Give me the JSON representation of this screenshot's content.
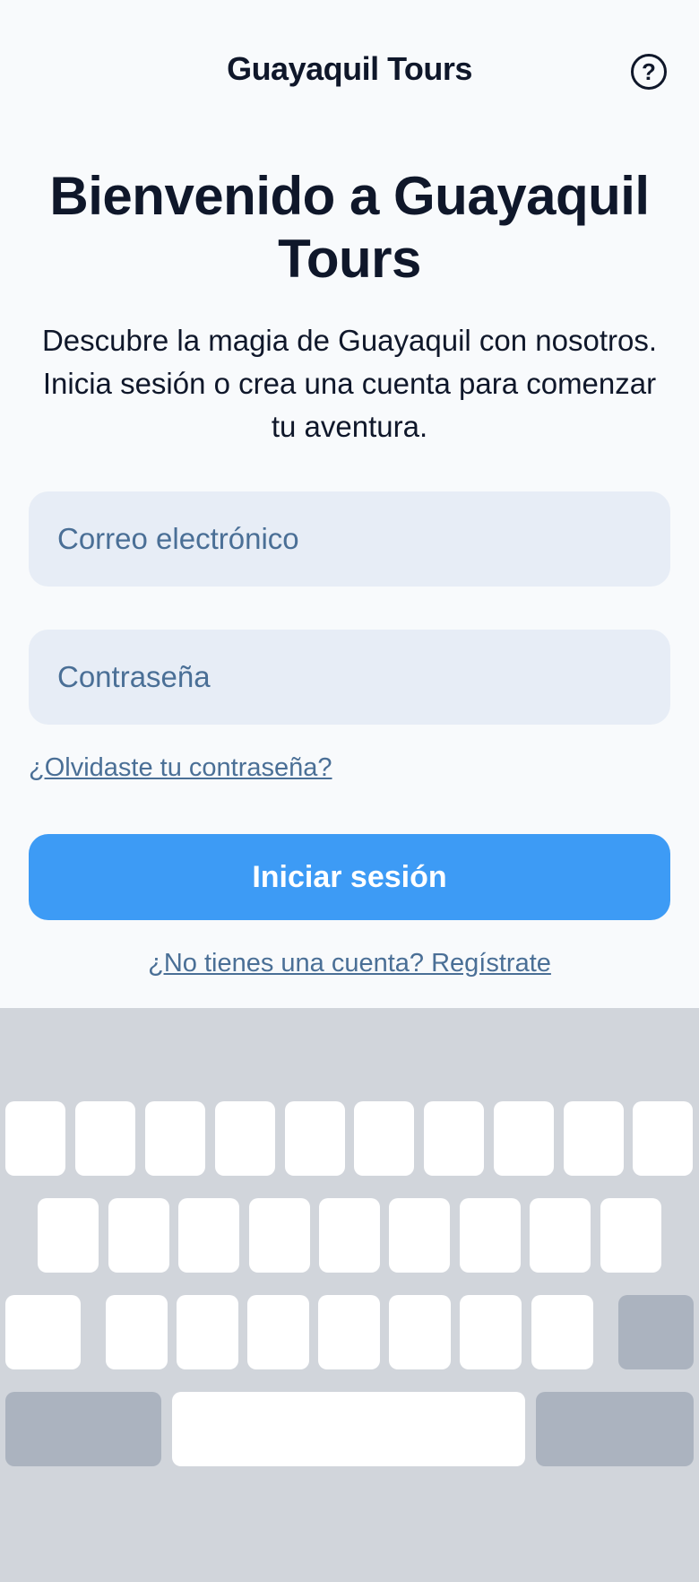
{
  "header": {
    "title": "Guayaquil Tours",
    "help_icon": "help-circle-icon",
    "help_glyph": "?"
  },
  "main": {
    "welcome_title": "Bienvenido a Guayaquil Tours",
    "subtitle": "Descubre la magia de Guayaquil con nosotros. Inicia sesión o crea una cuenta para comenzar tu aventura.",
    "email_placeholder": "Correo electrónico",
    "password_placeholder": "Contraseña",
    "forgot_password": "¿Olvidaste tu contraseña?",
    "login_button": "Iniciar sesión",
    "signup_link": "¿No tienes una cuenta? Regístrate"
  },
  "colors": {
    "background": "#f8fafc",
    "accent": "#3d9bf5",
    "input_bg": "#e7edf6",
    "link": "#4a6f96",
    "text": "#0f172a",
    "keyboard_bg": "#d1d5db"
  }
}
